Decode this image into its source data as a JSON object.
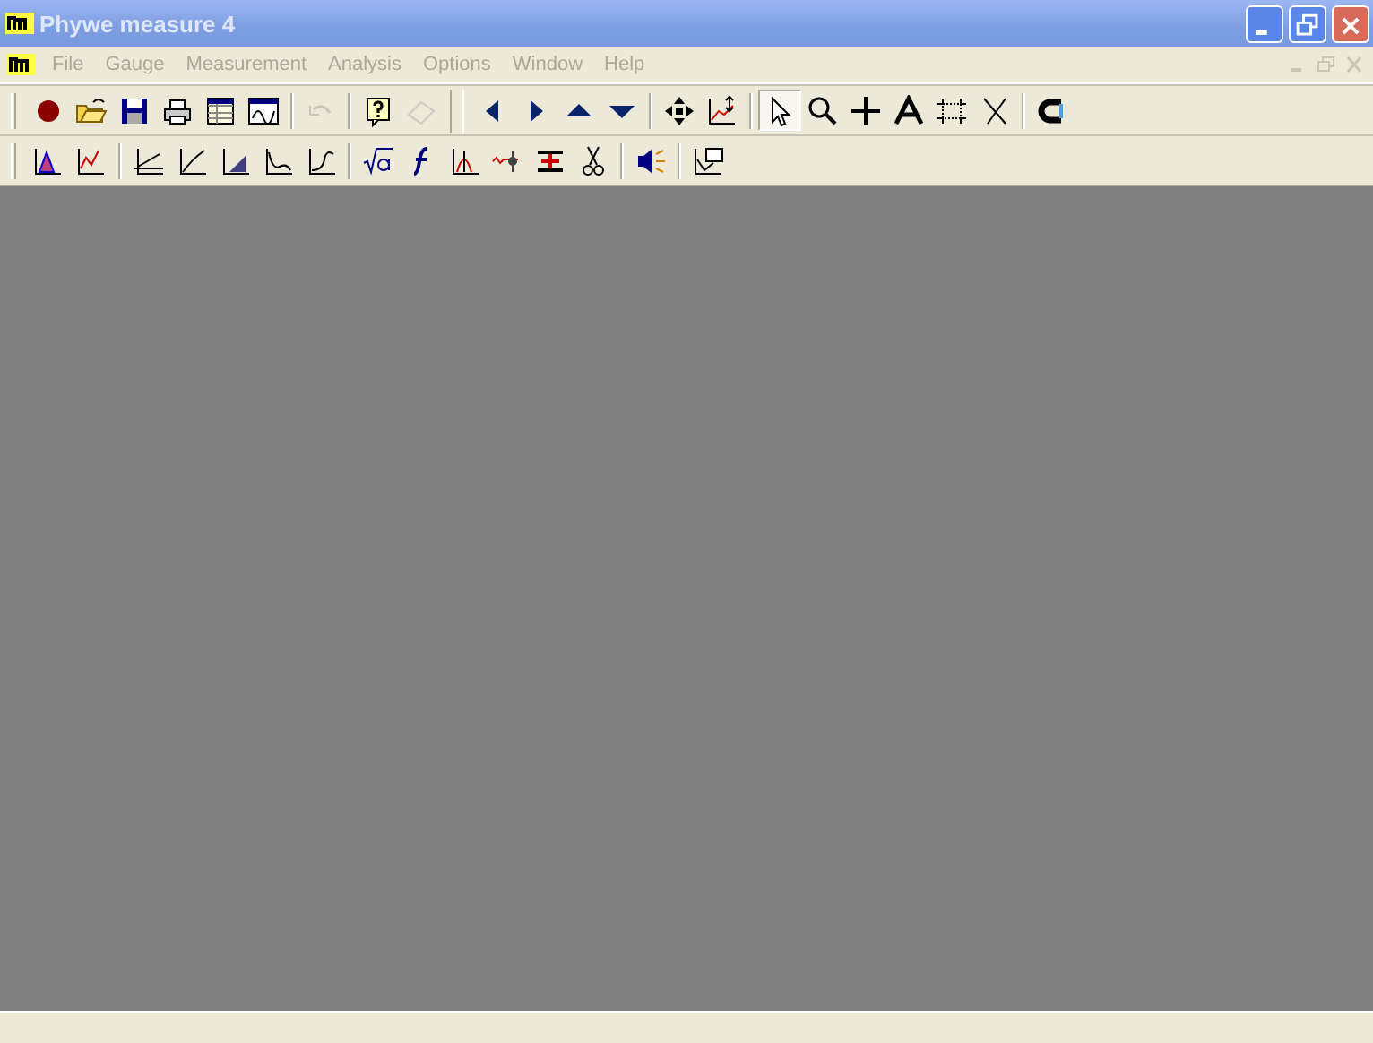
{
  "window": {
    "title": "Phywe measure 4",
    "active": false
  },
  "menu": [
    {
      "label": "File",
      "disabled": true
    },
    {
      "label": "Gauge",
      "disabled": true
    },
    {
      "label": "Measurement",
      "disabled": true
    },
    {
      "label": "Analysis",
      "disabled": true
    },
    {
      "label": "Options",
      "disabled": true
    },
    {
      "label": "Window",
      "disabled": true
    },
    {
      "label": "Help",
      "disabled": true
    }
  ],
  "toolbar_1": {
    "groups": [
      [
        {
          "disabled": false,
          "selected": false
        },
        {
          "disabled": false,
          "selected": false
        },
        {
          "disabled": false,
          "selected": false
        },
        {
          "disabled": false,
          "selected": false
        },
        {
          "disabled": false,
          "selected": false
        },
        {
          "disabled": false,
          "selected": false
        }
      ],
      [
        {
          "disabled": true,
          "selected": false
        }
      ],
      [
        {
          "disabled": false,
          "selected": false
        },
        {
          "disabled": true,
          "selected": false
        }
      ],
      [
        {
          "disabled": false,
          "selected": false
        },
        {
          "disabled": false,
          "selected": false
        },
        {
          "disabled": false,
          "selected": false
        },
        {
          "disabled": false,
          "selected": false
        }
      ],
      [
        {
          "disabled": false,
          "selected": false
        },
        {
          "disabled": false,
          "selected": false
        }
      ],
      [
        {
          "disabled": false,
          "selected": true
        },
        {
          "disabled": false,
          "selected": false
        },
        {
          "disabled": false,
          "selected": false
        },
        {
          "disabled": false,
          "selected": false
        },
        {
          "disabled": false,
          "selected": false
        },
        {
          "disabled": false,
          "selected": false
        }
      ],
      [
        {
          "disabled": false,
          "selected": false
        }
      ]
    ]
  },
  "toolbar_2": {
    "groups": [
      [
        {
          "disabled": false,
          "selected": false
        },
        {
          "disabled": false,
          "selected": false
        }
      ],
      [
        {
          "disabled": false,
          "selected": false
        },
        {
          "disabled": false,
          "selected": false
        },
        {
          "disabled": false,
          "selected": false
        },
        {
          "disabled": false,
          "selected": false
        },
        {
          "disabled": false,
          "selected": false
        }
      ],
      [
        {
          "disabled": false,
          "selected": false
        },
        {
          "disabled": false,
          "selected": false
        },
        {
          "disabled": false,
          "selected": false
        },
        {
          "disabled": false,
          "selected": false
        },
        {
          "disabled": false,
          "selected": false
        },
        {
          "disabled": false,
          "selected": false
        }
      ],
      [
        {
          "disabled": false,
          "selected": false
        }
      ],
      [
        {
          "disabled": false,
          "selected": false
        }
      ]
    ]
  }
}
